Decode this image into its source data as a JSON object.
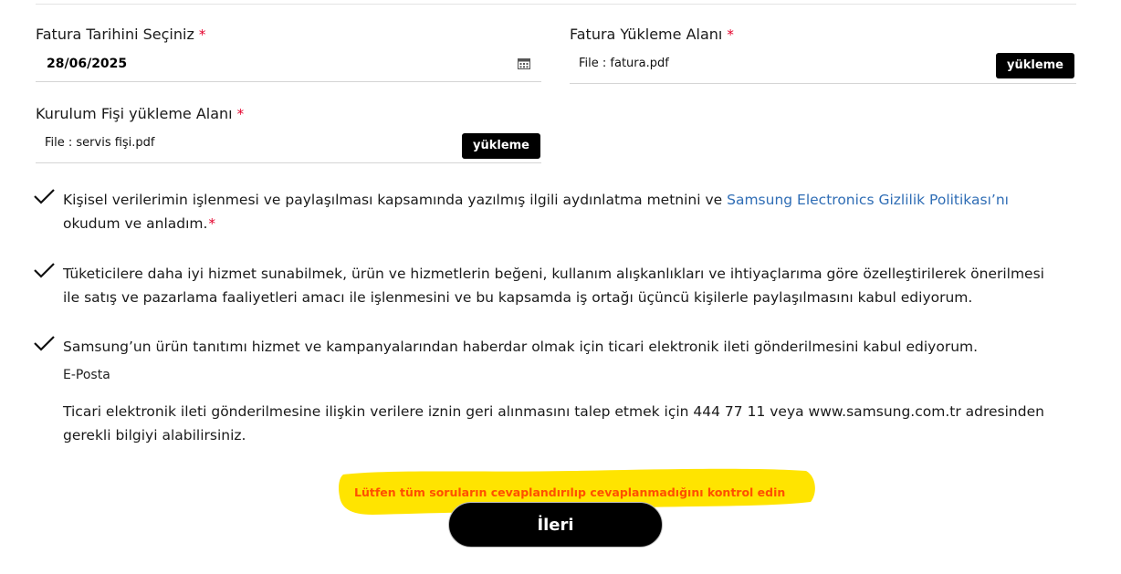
{
  "invoice_date": {
    "label": "Fatura Tarihini Seçiniz",
    "required_mark": "*",
    "value": "28/06/2025",
    "icon": "calendar-icon"
  },
  "invoice_upload": {
    "label": "Fatura Yükleme Alanı",
    "required_mark": "*",
    "file_text": "File : fatura.pdf",
    "button_label": "yükleme"
  },
  "receipt_upload": {
    "label": "Kurulum Fişi yükleme Alanı",
    "required_mark": "*",
    "file_text": "File : servis fişi.pdf",
    "button_label": "yükleme"
  },
  "consents": [
    {
      "text_before_link": "Kişisel verilerimin işlenmesi ve paylaşılması kapsamında yazılmış ilgili aydınlatma metnini ve ",
      "link_text": "Samsung Electronics Gizlilik Politikası’nı",
      "text_after_link": " okudum ve anladım.",
      "required_mark": "*",
      "checked": true
    },
    {
      "text": "Tüketicilere daha iyi hizmet sunabilmek, ürün ve hizmetlerin beğeni, kullanım alışkanlıkları ve ihtiyaçlarıma göre özelleştirilerek önerilmesi ile satış ve pazarlama faaliyetleri amacı ile işlenmesini ve bu kapsamda iş ortağı üçüncü kişilerle paylaşılmasını kabul ediyorum.",
      "checked": true
    },
    {
      "text": "Samsung’un ürün tanıtımı hizmet ve kampanyalarından haberdar olmak için ticari elektronik ileti gönderilmesini kabul ediyorum.",
      "channel_label": "E-Posta",
      "withdrawal_info": "Ticari elektronik ileti gönderilmesine ilişkin verilere iznin geri alınmasını talep etmek için 444 77 11 veya www.samsung.com.tr adresinden gerekli bilgiyi alabilirsiniz.",
      "checked": true
    }
  ],
  "warning": {
    "text": "Lütfen tüm soruların cevaplandırılıp cevaplanmadığını kontrol edin",
    "text_color": "#ff4f00",
    "highlight_color": "#ffe400"
  },
  "next_button": {
    "label": "İleri"
  },
  "colors": {
    "required": "#e4002b",
    "link": "#2f6db5",
    "button_bg": "#000000"
  }
}
